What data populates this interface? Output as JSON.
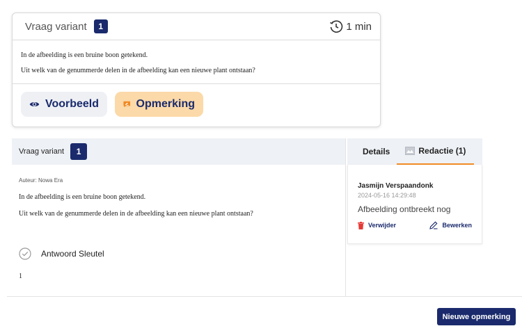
{
  "top": {
    "title": "Vraag variant",
    "badge": "1",
    "timer": "1 min",
    "question_line1": "In de afbeelding is een bruine boon getekend.",
    "question_line2": "Uit welk van de genummerde delen in de afbeelding kan een nieuwe plant ontstaan?",
    "preview_label": "Voorbeeld",
    "remark_label": "Opmerking"
  },
  "left": {
    "title": "Vraag variant",
    "badge": "1",
    "author": "Auteur: Nowa Era",
    "question_line1": "In de afbeelding is een bruine boon getekend.",
    "question_line2": "Uit welk van de genummerde delen in de afbeelding kan een nieuwe plant ontstaan?",
    "answer_key_label": "Antwoord Sleutel",
    "answer_value": "1"
  },
  "right": {
    "tab_details": "Details",
    "tab_redactie": "Redactie (1)",
    "comment": {
      "author": "Jasmijn Verspaandonk",
      "date": "2024-05-16 14:29:48",
      "text": "Afbeelding ontbreekt nog",
      "delete_label": "Verwijder",
      "edit_label": "Bewerken"
    }
  },
  "footer": {
    "new_remark_label": "Nieuwe opmerking"
  },
  "colors": {
    "navy": "#1a2a6c",
    "accent_orange": "#f08a24",
    "remark_bg": "#fbd9a8",
    "delete_red": "#e53935"
  }
}
